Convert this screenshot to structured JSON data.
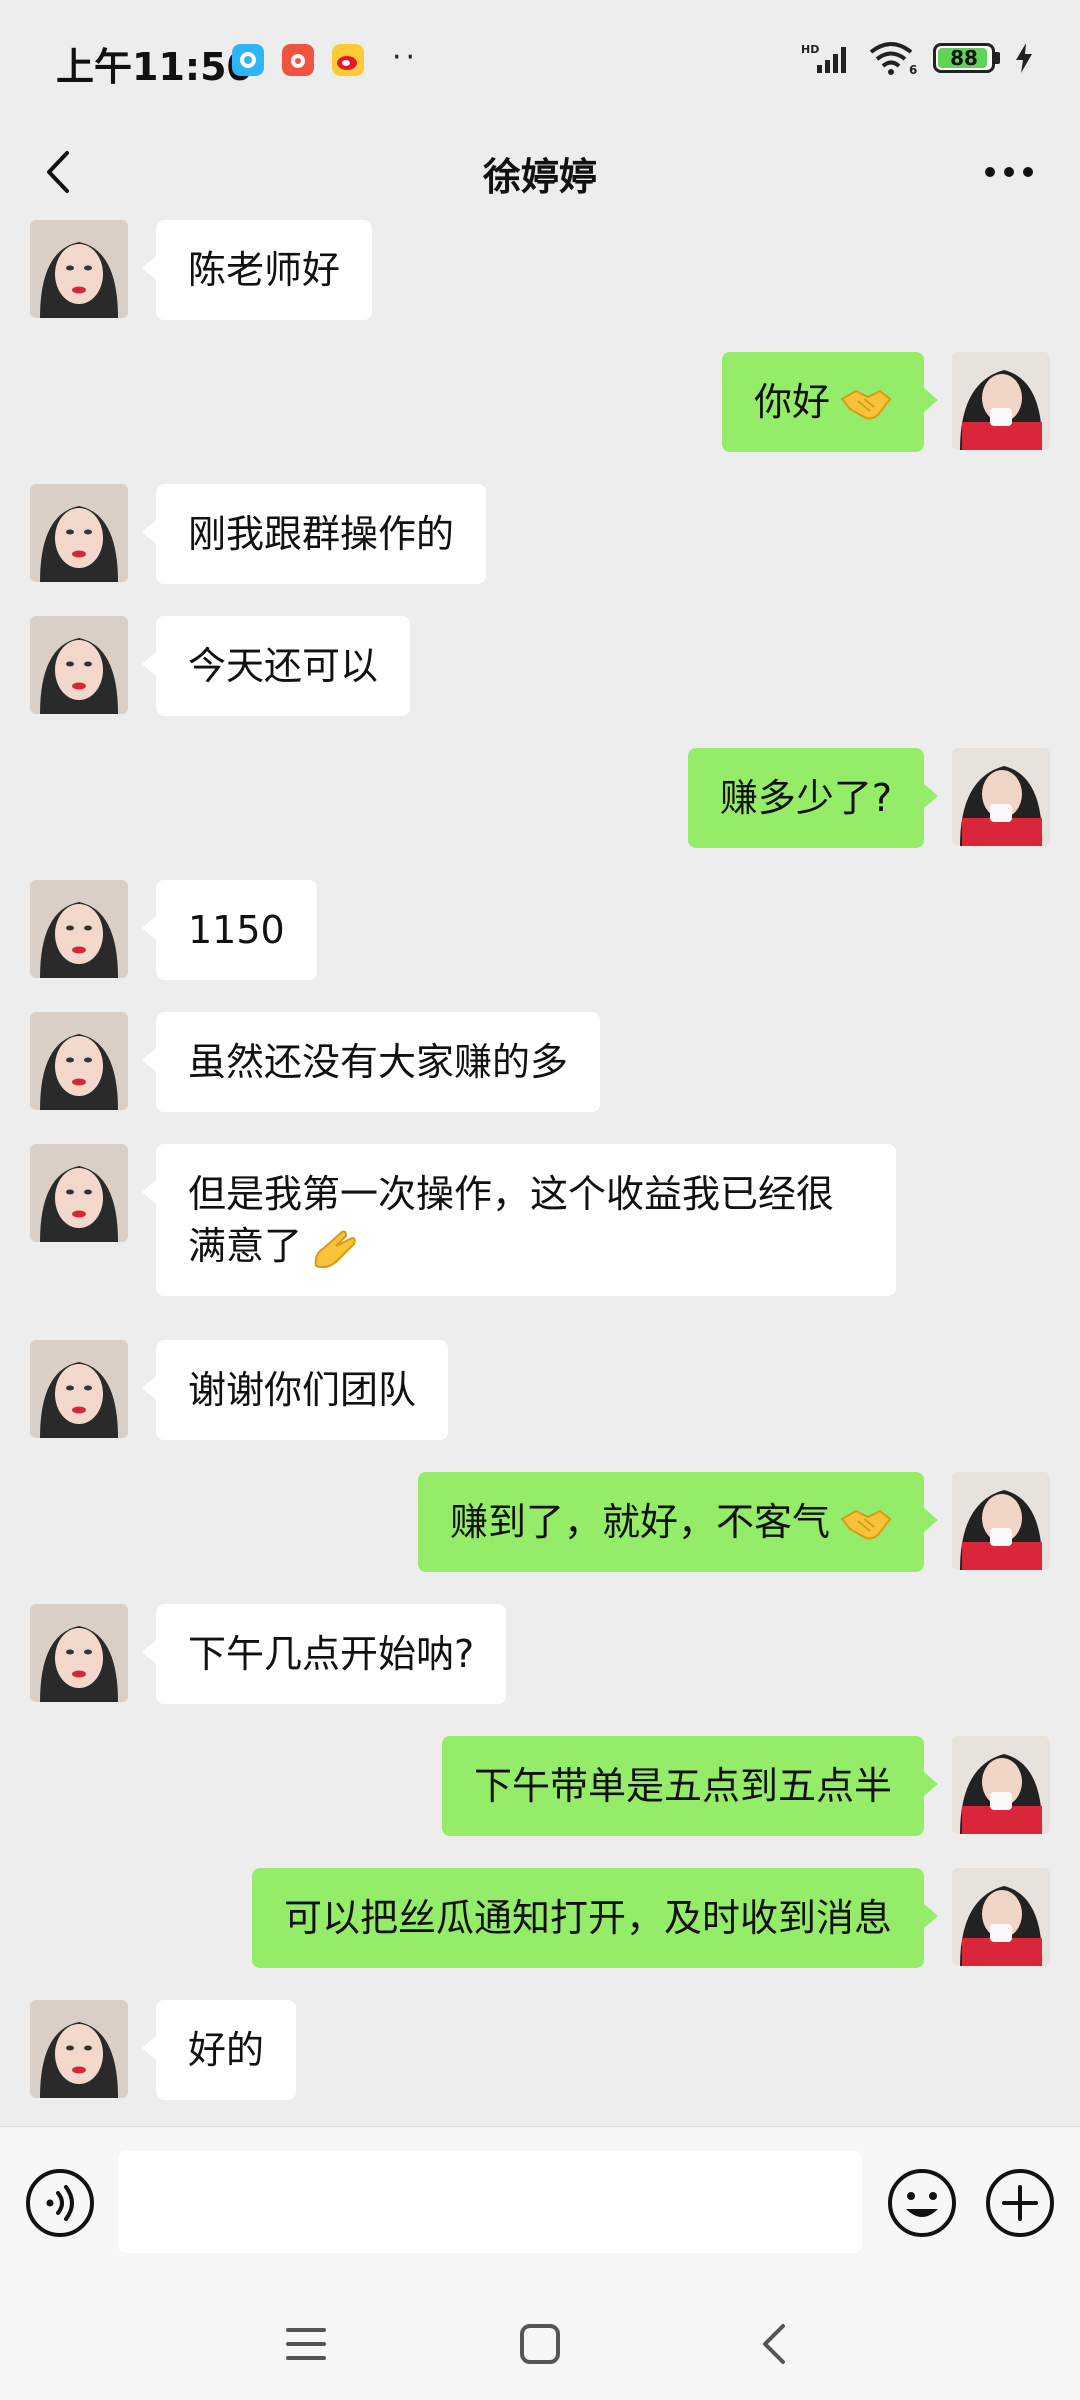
{
  "status_bar": {
    "time": "上午11:50",
    "dots": "··",
    "signal_label": "HD",
    "wifi_label": "6",
    "battery": "88"
  },
  "header": {
    "title": "徐婷婷"
  },
  "messages": [
    {
      "side": "left",
      "text": "陈老师好"
    },
    {
      "side": "right",
      "text": "你好",
      "emoji": "handshake"
    },
    {
      "side": "left",
      "text": "刚我跟群操作的"
    },
    {
      "side": "left",
      "text": "今天还可以"
    },
    {
      "side": "right",
      "text": "赚多少了?"
    },
    {
      "side": "left",
      "text": "1150"
    },
    {
      "side": "left",
      "text": "虽然还没有大家赚的多"
    },
    {
      "side": "left",
      "text": "但是我第一次操作，这个收益我已经很满意了",
      "emoji": "ok-hand"
    },
    {
      "side": "left",
      "text": "谢谢你们团队"
    },
    {
      "side": "right",
      "text": "赚到了，就好，不客气",
      "emoji": "handshake"
    },
    {
      "side": "left",
      "text": "下午几点开始呐?"
    },
    {
      "side": "right",
      "text": "下午带单是五点到五点半"
    },
    {
      "side": "right",
      "text": "可以把丝瓜通知打开，及时收到消息"
    },
    {
      "side": "left",
      "text": "好的"
    }
  ],
  "input": {
    "placeholder": "",
    "value": ""
  },
  "colors": {
    "background": "#ededed",
    "outgoing_bubble": "#95ec69",
    "incoming_bubble": "#ffffff"
  }
}
